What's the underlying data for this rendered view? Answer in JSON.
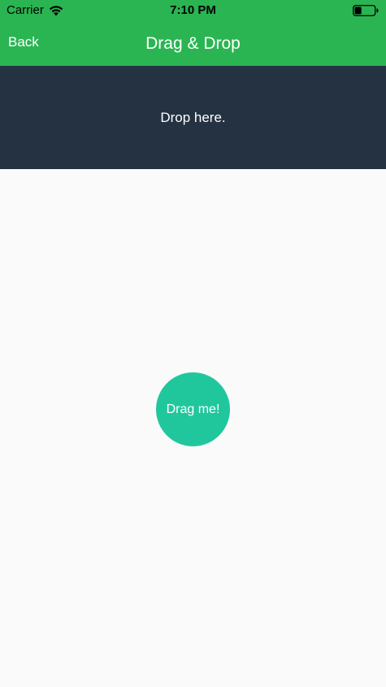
{
  "status_bar": {
    "carrier": "Carrier",
    "time": "7:10 PM",
    "wifi_icon": "wifi-icon",
    "battery_icon": "battery-icon",
    "battery_level": 0.35
  },
  "nav": {
    "back_label": "Back",
    "title": "Drag & Drop"
  },
  "drop_zone": {
    "text": "Drop here."
  },
  "draggable": {
    "label": "Drag me!"
  },
  "colors": {
    "nav_bg": "#2ab552",
    "drop_zone_bg": "#243242",
    "draggable_bg": "#21c79c",
    "page_bg": "#fafafa"
  }
}
